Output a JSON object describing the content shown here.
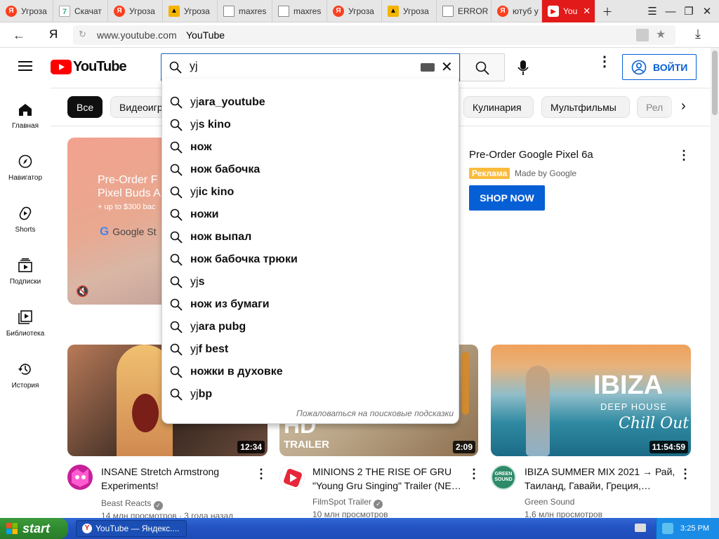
{
  "browser": {
    "tabs": [
      {
        "label": "Угроза",
        "icon": "yandex-icon"
      },
      {
        "label": "Скачат",
        "icon": "download-icon"
      },
      {
        "label": "Угроза",
        "icon": "yandex-icon"
      },
      {
        "label": "Угроза",
        "icon": "warning-icon"
      },
      {
        "label": "maxres",
        "icon": "document-icon"
      },
      {
        "label": "maxres",
        "icon": "document-icon"
      },
      {
        "label": "Угроза",
        "icon": "yandex-icon"
      },
      {
        "label": "Угроза",
        "icon": "warning-icon"
      },
      {
        "label": "ERROR",
        "icon": "document-icon"
      },
      {
        "label": "ютуб у",
        "icon": "yandex-icon"
      },
      {
        "label": "You",
        "icon": "youtube-icon",
        "active": true
      }
    ],
    "address": {
      "url": "www.youtube.com",
      "title": "YouTube"
    }
  },
  "youtube": {
    "logo_text": "YouTube",
    "search": {
      "value": "yj"
    },
    "signin_label": "ВОЙТИ",
    "nav": [
      {
        "label": "Главная",
        "icon": "home-icon"
      },
      {
        "label": "Навигатор",
        "icon": "compass-icon"
      },
      {
        "label": "Shorts",
        "icon": "shorts-icon"
      },
      {
        "label": "Подписки",
        "icon": "subscriptions-icon"
      },
      {
        "label": "Библиотека",
        "icon": "library-icon"
      },
      {
        "label": "История",
        "icon": "history-icon"
      }
    ],
    "chips": [
      "Все",
      "Видеоигр",
      "Кулинария",
      "Мультфильмы",
      "Рел"
    ],
    "suggestions": [
      {
        "prefix": "yj",
        "rest": "ara_youtube"
      },
      {
        "prefix": "yj",
        "rest": "s kino"
      },
      {
        "prefix": "",
        "rest": "нож"
      },
      {
        "prefix": "",
        "rest": "нож бабочка"
      },
      {
        "prefix": "yj",
        "rest": "ic kino"
      },
      {
        "prefix": "",
        "rest": "ножи"
      },
      {
        "prefix": "",
        "rest": "нож выпал"
      },
      {
        "prefix": "",
        "rest": "нож бабочка трюки"
      },
      {
        "prefix": "yj",
        "rest": "s"
      },
      {
        "prefix": "",
        "rest": "нож из бумаги"
      },
      {
        "prefix": "yj",
        "rest": "ara pubg"
      },
      {
        "prefix": "yj",
        "rest": "f best"
      },
      {
        "prefix": "",
        "rest": "ножки в духовке"
      },
      {
        "prefix": "yj",
        "rest": "bp"
      }
    ],
    "report_suggestions": "Пожаловаться на поисковые подсказки",
    "ad": {
      "banner_title": "Pre-Order F",
      "banner_line2": "Pixel Buds A",
      "banner_line3": "+ up to $300 bac",
      "banner_store": "Google St",
      "title": "Pre-Order Google Pixel 6a",
      "badge": "Реклама",
      "advertiser": "Made by Google",
      "cta": "SHOP NOW"
    },
    "videos": [
      {
        "title": "INSANE Stretch Armstrong Experiments!",
        "channel": "Beast Reacts",
        "meta": "14 млн просмотров · 3 года назад",
        "duration": "12:34",
        "verified": true,
        "thumb_text": ""
      },
      {
        "title": "MINIONS 2 THE RISE OF GRU \"Young Gru Singing\" Trailer (NE…",
        "channel": "FilmSpot Trailer",
        "meta": "10 млн просмотров",
        "duration": "2:09",
        "verified": true,
        "thumb_text": "HD",
        "thumb_text2": "TRAILER"
      },
      {
        "title": "IBIZA SUMMER MIX 2021 → Рай, Таиланд, Гавайи, Греция,…",
        "channel": "Green Sound",
        "meta": "1,6 млн просмотров",
        "duration": "11:54:59",
        "verified": false,
        "thumb_text": "IBIZA",
        "thumb_text2": "DEEP HOUSE",
        "thumb_text3": "Chill Out",
        "avatar_text": "GREEN SOUND"
      }
    ]
  },
  "taskbar": {
    "start_label": "start",
    "window_label": "YouTube — Яндекс....",
    "clock": "3:25 PM"
  },
  "colors": {
    "youtube_red": "#ff0000",
    "accent_blue": "#065fd4",
    "ad_badge": "#f9bb3c",
    "active_tab": "#e21a1a"
  }
}
